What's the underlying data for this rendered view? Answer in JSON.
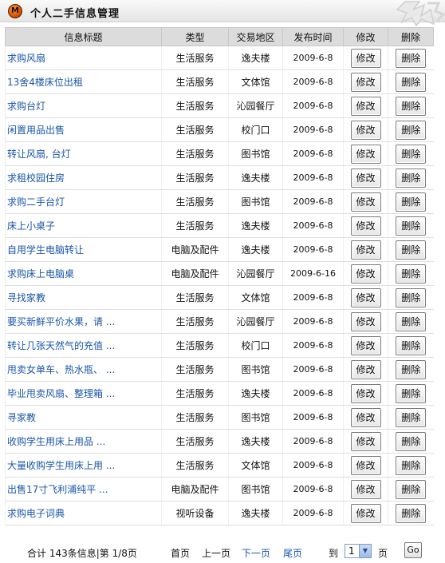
{
  "header": {
    "logo_letter": "M",
    "title": "个人二手信息管理"
  },
  "table": {
    "columns": [
      "信息标题",
      "类型",
      "交易地区",
      "发布时间",
      "修改",
      "删除"
    ],
    "edit_label": "修改",
    "delete_label": "删除",
    "rows": [
      [
        "求购风扇",
        "生活服务",
        "逸夫楼",
        "2009-6-8"
      ],
      [
        "13舍4楼床位出租",
        "生活服务",
        "文体馆",
        "2009-6-8"
      ],
      [
        "求购台灯",
        "生活服务",
        "沁园餐厅",
        "2009-6-8"
      ],
      [
        "闲置用品出售",
        "生活服务",
        "校门口",
        "2009-6-8"
      ],
      [
        "转让风扇, 台灯",
        "生活服务",
        "图书馆",
        "2009-6-8"
      ],
      [
        "求租校园住房",
        "生活服务",
        "逸夫楼",
        "2009-6-8"
      ],
      [
        "求购二手台灯",
        "生活服务",
        "图书馆",
        "2009-6-8"
      ],
      [
        "床上小桌子",
        "生活服务",
        "逸夫楼",
        "2009-6-8"
      ],
      [
        "自用学生电脑转让",
        "电脑及配件",
        "逸夫楼",
        "2009-6-8"
      ],
      [
        "求购床上电脑桌",
        "电脑及配件",
        "沁园餐厅",
        "2009-6-16"
      ],
      [
        "寻找家教",
        "生活服务",
        "文体馆",
        "2009-6-8"
      ],
      [
        "要买新鲜平价水果，请 ...",
        "生活服务",
        "沁园餐厅",
        "2009-6-8"
      ],
      [
        "转让几张天然气的充值 ...",
        "生活服务",
        "校门口",
        "2009-6-8"
      ],
      [
        "甩卖女单车、热水瓶、 ...",
        "生活服务",
        "图书馆",
        "2009-6-8"
      ],
      [
        "毕业甩卖风扇、整理箱 ...",
        "生活服务",
        "逸夫楼",
        "2009-6-8"
      ],
      [
        "寻家教",
        "生活服务",
        "图书馆",
        "2009-6-8"
      ],
      [
        "收购学生用床上用品 ...",
        "生活服务",
        "逸夫楼",
        "2009-6-8"
      ],
      [
        "大量收购学生用床上用 ...",
        "生活服务",
        "文体馆",
        "2009-6-8"
      ],
      [
        "出售17寸飞利浦纯平 ...",
        "电脑及配件",
        "图书馆",
        "2009-6-8"
      ],
      [
        "求购电子词典",
        "视听设备",
        "逸夫楼",
        "2009-6-8"
      ]
    ]
  },
  "pager": {
    "summary": "合计 143条信息|第 1/8页",
    "first": "首页",
    "prev": "上一页",
    "next": "下一页",
    "last": "尾页",
    "goto_prefix": "到",
    "selected_page": "1",
    "goto_suffix": "页",
    "go_label": "Go"
  }
}
